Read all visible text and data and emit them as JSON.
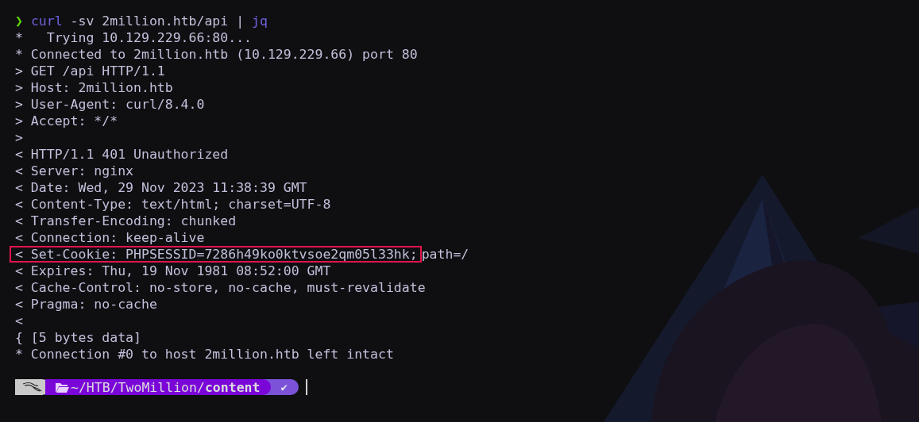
{
  "command": {
    "prompt": "❯",
    "program": "curl",
    "args": "-sv 2million.htb/api |",
    "pipe_program": "jq"
  },
  "output": [
    {
      "text": "*   Trying 10.129.229.66:80...",
      "highlighted": false
    },
    {
      "text": "* Connected to 2million.htb (10.129.229.66) port 80",
      "highlighted": false
    },
    {
      "text": "> GET /api HTTP/1.1",
      "highlighted": false
    },
    {
      "text": "> Host: 2million.htb",
      "highlighted": false
    },
    {
      "text": "> User-Agent: curl/8.4.0",
      "highlighted": false
    },
    {
      "text": "> Accept: */*",
      "highlighted": false
    },
    {
      "text": ">",
      "highlighted": false
    },
    {
      "text": "< HTTP/1.1 401 Unauthorized",
      "highlighted": false
    },
    {
      "text": "< Server: nginx",
      "highlighted": false
    },
    {
      "text": "< Date: Wed, 29 Nov 2023 11:38:39 GMT",
      "highlighted": false
    },
    {
      "text": "< Content-Type: text/html; charset=UTF-8",
      "highlighted": false
    },
    {
      "text": "< Transfer-Encoding: chunked",
      "highlighted": false
    },
    {
      "text": "< Connection: keep-alive",
      "highlighted": false
    },
    {
      "text": "< Set-Cookie: PHPSESSID=7286h49ko0ktvsoe2qm05l33hk;",
      "after": "path=/",
      "highlighted": true
    },
    {
      "text": "< Expires: Thu, 19 Nov 1981 08:52:00 GMT",
      "highlighted": false
    },
    {
      "text": "< Cache-Control: no-store, no-cache, must-revalidate",
      "highlighted": false
    },
    {
      "text": "< Pragma: no-cache",
      "highlighted": false
    },
    {
      "text": "<",
      "highlighted": false
    },
    {
      "text": "{ [5 bytes data]",
      "highlighted": false
    },
    {
      "text": "* Connection #0 to host 2million.htb left intact",
      "highlighted": false
    }
  ],
  "prompt_bar": {
    "path": "~/HTB/TwoMillion/**content**",
    "status": "✔"
  }
}
